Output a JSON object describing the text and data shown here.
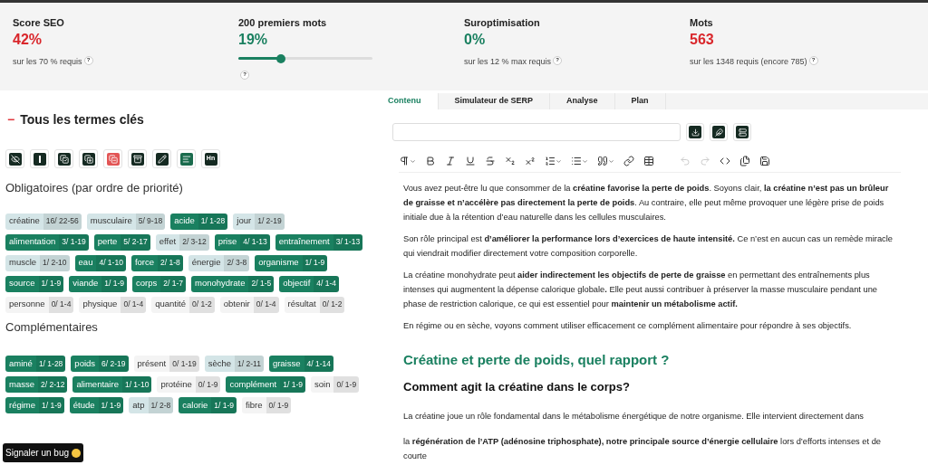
{
  "stats": [
    {
      "title": "Score SEO",
      "value": "42%",
      "color": "#d9262b",
      "note": "sur les 70 % requis",
      "help": "?"
    },
    {
      "title": "200 premiers mots",
      "value": "19%",
      "color": "#1a8060",
      "level": 0.32,
      "help": "?"
    },
    {
      "title": "Suroptimisation",
      "value": "0%",
      "color": "#1a8060",
      "note": "sur les 12 % max requis",
      "help": "?"
    },
    {
      "title": "Mots",
      "value": "563",
      "color": "#d9262b",
      "note": "sur les 1348 requis (encore 785)",
      "help": "?"
    }
  ],
  "terms_panel": {
    "collapse_sign": "−",
    "title": "Tous les termes clés",
    "heading_tool_label": "Hn",
    "groups": [
      {
        "title": "Obligatoires (par ordre de priorité)",
        "terms": [
          {
            "label": "créatine",
            "count": "16/ 22-56",
            "color": "#d4e5e7"
          },
          {
            "label": "musculaire",
            "count": "5/ 9-18",
            "color": "#d4e5e7"
          },
          {
            "label": "acide",
            "count": "1/ 1-28",
            "color": "#1a8060"
          },
          {
            "label": "jour",
            "count": "1/ 2-19",
            "color": "#d4e5e7"
          },
          {
            "label": "alimentation",
            "count": "3/ 1-19",
            "color": "#1a8060"
          },
          {
            "label": "perte",
            "count": "5/ 2-17",
            "color": "#1a8060"
          },
          {
            "label": "effet",
            "count": "2/ 3-12",
            "color": "#d4e5e7"
          },
          {
            "label": "prise",
            "count": "4/ 1-13",
            "color": "#1a8060"
          },
          {
            "label": "entraînement",
            "count": "3/ 1-13",
            "color": "#1a8060"
          },
          {
            "label": "muscle",
            "count": "1/ 2-10",
            "color": "#d4e5e7"
          },
          {
            "label": "eau",
            "count": "4/ 1-10",
            "color": "#1a8060"
          },
          {
            "label": "force",
            "count": "2/ 1-8",
            "color": "#1a8060"
          },
          {
            "label": "énergie",
            "count": "2/ 3-8",
            "color": "#d4e5e7"
          },
          {
            "label": "organisme",
            "count": "1/ 1-9",
            "color": "#1a8060"
          },
          {
            "label": "source",
            "count": "1/ 1-9",
            "color": "#1a8060"
          },
          {
            "label": "viande",
            "count": "1/ 1-9",
            "color": "#1a8060"
          },
          {
            "label": "corps",
            "count": "2/ 1-7",
            "color": "#1a8060"
          },
          {
            "label": "monohydrate",
            "count": "2/ 1-5",
            "color": "#1a8060"
          },
          {
            "label": "objectif",
            "count": "4/ 1-4",
            "color": "#1a8060"
          },
          {
            "label": "personne",
            "count": "0/ 1-4",
            "color": "#f4f4f4"
          },
          {
            "label": "physique",
            "count": "0/ 1-4",
            "color": "#f4f4f4"
          },
          {
            "label": "quantité",
            "count": "0/ 1-2",
            "color": "#f4f4f4"
          },
          {
            "label": "obtenir",
            "count": "0/ 1-4",
            "color": "#f4f4f4"
          },
          {
            "label": "résultat",
            "count": "0/ 1-2",
            "color": "#f4f4f4"
          }
        ]
      },
      {
        "title": "Complémentaires",
        "terms": [
          {
            "label": "aminé",
            "count": "1/ 1-28",
            "color": "#1a8060"
          },
          {
            "label": "poids",
            "count": "6/ 2-19",
            "color": "#1a8060"
          },
          {
            "label": "présent",
            "count": "0/ 1-19",
            "color": "#f4f4f4"
          },
          {
            "label": "sèche",
            "count": "1/ 2-11",
            "color": "#d4e5e7"
          },
          {
            "label": "graisse",
            "count": "4/ 1-14",
            "color": "#1a8060"
          },
          {
            "label": "masse",
            "count": "2/ 2-12",
            "color": "#1a8060"
          },
          {
            "label": "alimentaire",
            "count": "1/ 1-10",
            "color": "#1a8060"
          },
          {
            "label": "protéine",
            "count": "0/ 1-9",
            "color": "#f4f4f4"
          },
          {
            "label": "complément",
            "count": "1/ 1-9",
            "color": "#1a8060"
          },
          {
            "label": "soin",
            "count": "0/ 1-9",
            "color": "#f4f4f4"
          },
          {
            "label": "régime",
            "count": "1/ 1-9",
            "color": "#1a8060"
          },
          {
            "label": "étude",
            "count": "1/ 1-9",
            "color": "#1a8060"
          },
          {
            "label": "atp",
            "count": "1/ 2-8",
            "color": "#d4e5e7"
          },
          {
            "label": "calorie",
            "count": "1/ 1-9",
            "color": "#1a8060"
          },
          {
            "label": "fibre",
            "count": "0/ 1-9",
            "color": "#f4f4f4"
          }
        ]
      }
    ]
  },
  "bug_button": "Signaler un bug",
  "tabs": [
    {
      "label": "Contenu",
      "selected": true
    },
    {
      "label": "Simulateur de SERP",
      "selected": false
    },
    {
      "label": "Analyse",
      "selected": false
    },
    {
      "label": "Plan",
      "selected": false
    }
  ],
  "content": [
    {
      "kind": "p",
      "text": "Vous avez peut-être lu que consommer de la **créatine favorise la perte de poids**. Soyons clair, **la créatine n’est pas un brûleur de graisse et n’accélère pas directement la perte de poids**. Au contraire, elle peut même provoquer une légère prise de poids initiale due à la rétention d’eau naturelle dans les cellules musculaires."
    },
    {
      "kind": "p",
      "text": "Son rôle principal est **d’améliorer la performance lors d’exercices de haute intensité.** Ce n’est en aucun cas un remède miracle qui viendrait modifier directement votre composition corporelle."
    },
    {
      "kind": "p",
      "text": "La créatine monohydrate peut **aider indirectement les objectifs de perte de graisse** en permettant des entraînements plus intenses qui augmentent la dépense calorique globale**.** Elle peut aussi contribuer à préserver la masse musculaire pendant une phase de restriction calorique, ce qui est essentiel pour **maintenir un métabolisme actif.**"
    },
    {
      "kind": "p",
      "text": "En régime ou en sèche, voyons comment utiliser efficacement ce complément alimentaire pour répondre à ses objectifs."
    },
    {
      "kind": "h2",
      "text": "Créatine et perte de poids, quel rapport ?"
    },
    {
      "kind": "h3",
      "text": "Comment agit la créatine dans le corps?"
    },
    {
      "kind": "p",
      "text": "La créatine joue un rôle fondamental dans le métabolisme énergétique de notre organisme. Elle intervient directement dans"
    },
    {
      "kind": "p",
      "text": "la **régénération  de l’ATP (adénosine triphosphate), notre principale source d’énergie cellulaire** lors d’efforts intenses et de courte"
    }
  ]
}
